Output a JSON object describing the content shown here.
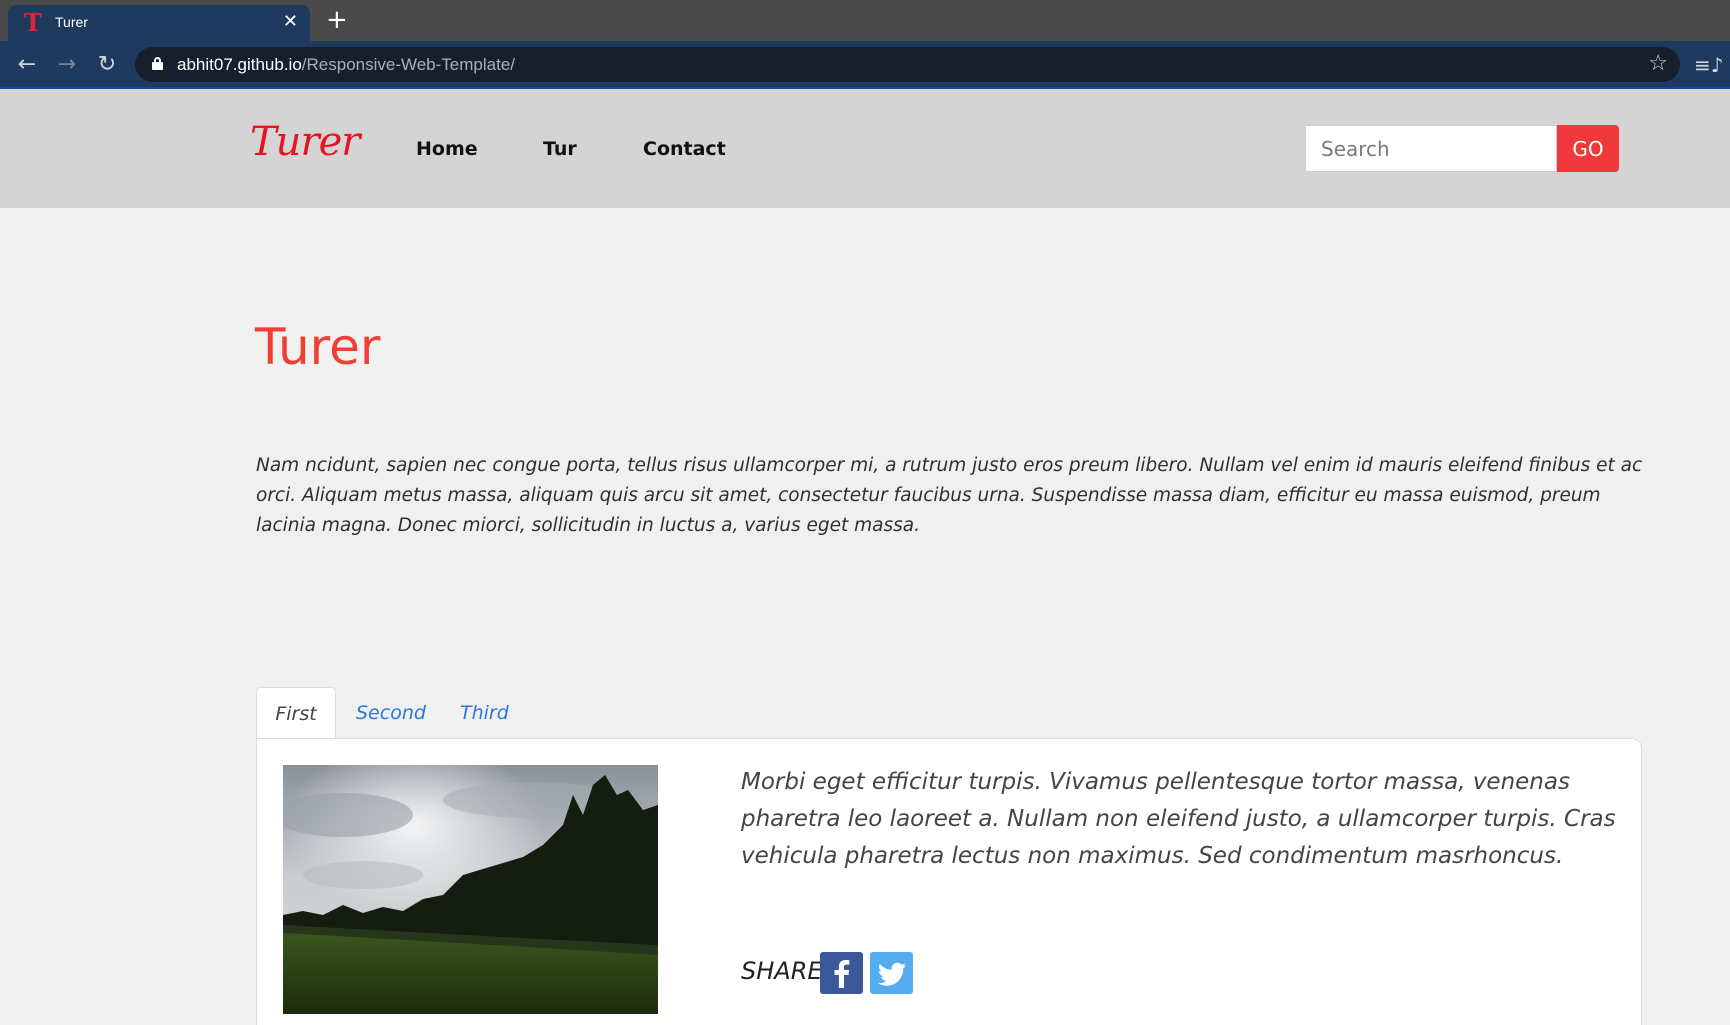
{
  "browser": {
    "tab_title": "Turer",
    "tab_favicon_letter": "T",
    "url_domain": "abhit07.github.io",
    "url_path": "/Responsive-Web-Template/"
  },
  "header": {
    "logo": "Turer",
    "nav": [
      "Home",
      "Tur",
      "Contact"
    ],
    "search_placeholder": "Search",
    "go_label": "GO"
  },
  "main": {
    "title": "Turer",
    "intro": "Nam ncidunt, sapien nec congue porta, tellus risus ullamcorper mi, a rutrum justo eros preum libero. Nullam vel enim id mauris eleifend finibus et ac orci. Aliquam metus massa, aliquam quis arcu sit amet, consectetur faucibus urna. Suspendisse massa diam, efficitur eu massa euismod, preum lacinia magna. Donec miorci, sollicitudin in luctus a, varius eget massa.",
    "tabs": [
      "First",
      "Second",
      "Third"
    ],
    "panel_text": "Morbi eget efficitur turpis. Vivamus pellentesque tortor massa, venenas pharetra leo laoreet a. Nullam non eleifend justo, a ullamcorper turpis. Cras vehicula pharetra lectus non maximus. Sed condimentum masrhoncus.",
    "share_label": "SHARE"
  },
  "colors": {
    "accent": "#f0383a",
    "logo": "#e8131f",
    "link": "#2a78d8",
    "facebook": "#3b5998",
    "twitter": "#55acee"
  }
}
